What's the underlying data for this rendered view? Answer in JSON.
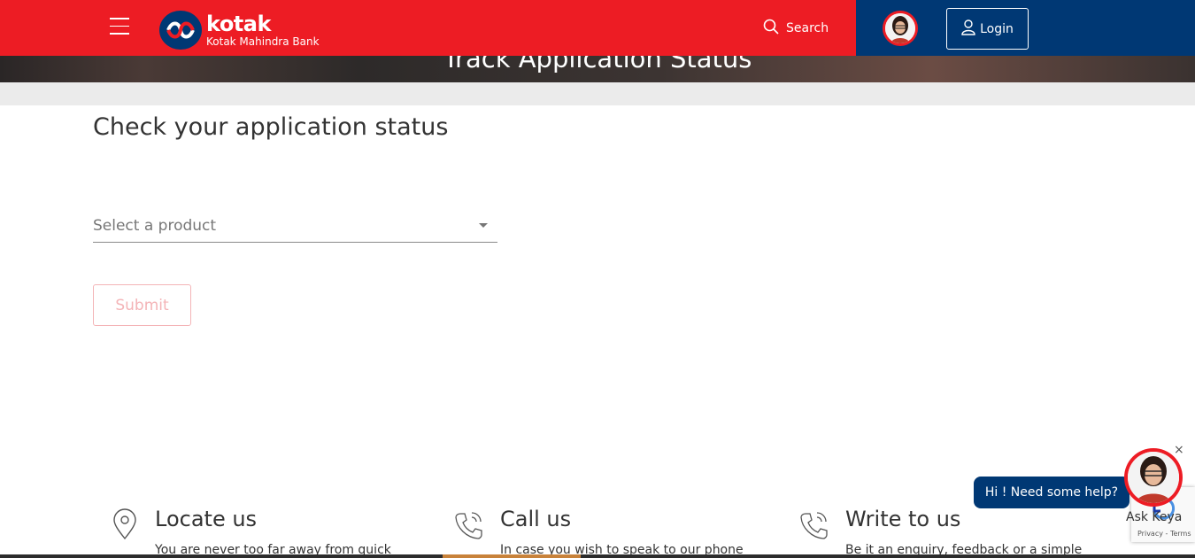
{
  "header": {
    "logo_name": "kotak",
    "logo_sub": "Kotak Mahindra Bank",
    "search_label": "Search",
    "login_label": "Login"
  },
  "banner": {
    "title": "Track Application Status"
  },
  "main": {
    "title": "Check your application status",
    "select_placeholder": "Select a product",
    "submit_label": "Submit"
  },
  "footer": {
    "items": [
      {
        "title": "Locate us",
        "desc": "You are never too far away from quick",
        "icon": "location-pin-icon"
      },
      {
        "title": "Call us",
        "desc": "In case you wish to speak to our phone",
        "icon": "phone-icon"
      },
      {
        "title": "Write to us",
        "desc": "Be it an enquiry, feedback or a simple",
        "icon": "phone-icon"
      }
    ]
  },
  "chat": {
    "bubble": "Hi ! Need some help?",
    "name": "Ask Keya",
    "close": "×"
  },
  "recaptcha": {
    "links": "Privacy - Terms"
  },
  "colors": {
    "brand_red": "#ed1c24",
    "brand_blue": "#003874"
  }
}
